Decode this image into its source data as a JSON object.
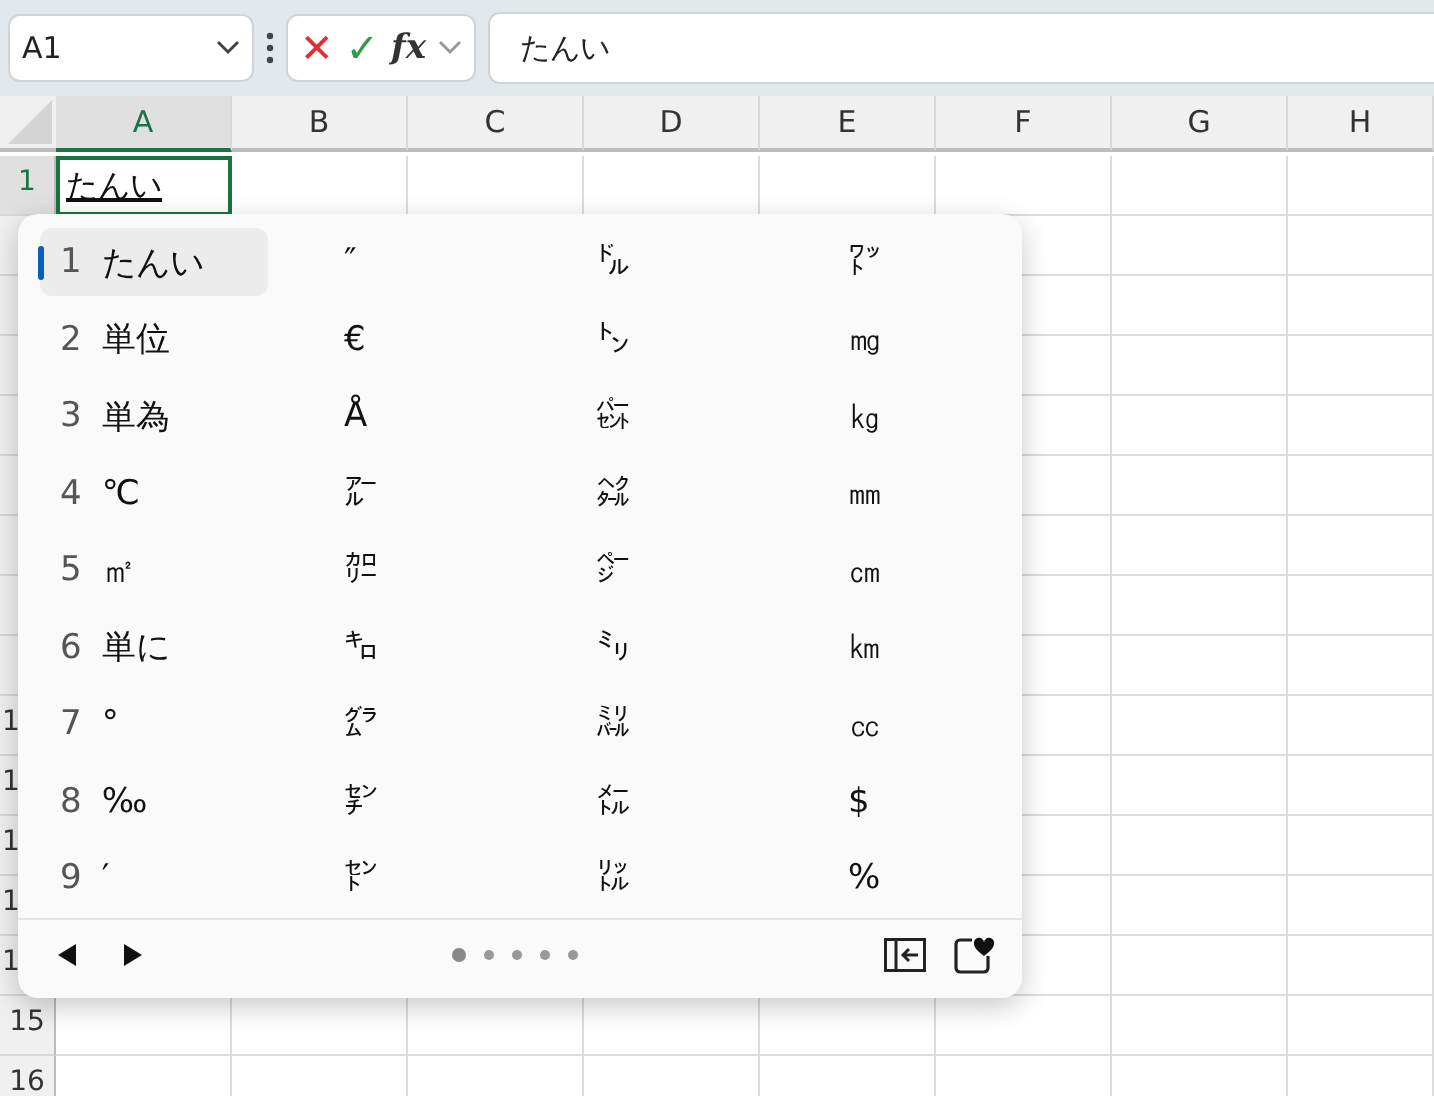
{
  "formula_bar": {
    "name_box": "A1",
    "cancel": "✕",
    "enter": "✓",
    "fx": "fx",
    "formula": "たんい"
  },
  "columns": [
    {
      "label": "A",
      "selected": true
    },
    {
      "label": "B",
      "selected": false
    },
    {
      "label": "C",
      "selected": false
    },
    {
      "label": "D",
      "selected": false
    },
    {
      "label": "E",
      "selected": false
    },
    {
      "label": "F",
      "selected": false
    },
    {
      "label": "G",
      "selected": false
    },
    {
      "label": "H",
      "selected": false
    }
  ],
  "top_rows": [
    {
      "label": "1",
      "selected": true
    }
  ],
  "lower_rows": [
    {
      "label": "1",
      "selected": false
    },
    {
      "label": "1",
      "selected": false
    },
    {
      "label": "1",
      "selected": false
    },
    {
      "label": "1",
      "selected": false
    },
    {
      "label": "1",
      "selected": false
    },
    {
      "label": "15",
      "selected": false
    },
    {
      "label": "16",
      "selected": false
    }
  ],
  "active_cell": {
    "value": "たんい",
    "composing": true
  },
  "candidates": {
    "rows": [
      {
        "number": "1",
        "text": "たんい",
        "selected": true,
        "others": [
          "″",
          "㌦",
          "㍗"
        ]
      },
      {
        "number": "2",
        "text": "単位",
        "selected": false,
        "others": [
          "€",
          "㌧",
          "㎎"
        ]
      },
      {
        "number": "3",
        "text": "単為",
        "selected": false,
        "others": [
          "Å",
          "㌫",
          "㎏"
        ]
      },
      {
        "number": "4",
        "text": "℃",
        "selected": false,
        "others": [
          "㌃",
          "㌶",
          "㎜"
        ]
      },
      {
        "number": "5",
        "text": "㎡",
        "selected": false,
        "others": [
          "㌍",
          "㌻",
          "㎝"
        ]
      },
      {
        "number": "6",
        "text": "単に",
        "selected": false,
        "others": [
          "㌔",
          "㍉",
          "㎞"
        ]
      },
      {
        "number": "7",
        "text": "°",
        "selected": false,
        "others": [
          "㌘",
          "㍊",
          "㏄"
        ]
      },
      {
        "number": "8",
        "text": "‰",
        "selected": false,
        "others": [
          "㌢",
          "㍍",
          "$"
        ]
      },
      {
        "number": "9",
        "text": "′",
        "selected": false,
        "others": [
          "㌣",
          "㍑",
          "%"
        ]
      }
    ],
    "pages": [
      {
        "selected": true
      },
      {
        "selected": false
      },
      {
        "selected": false
      },
      {
        "selected": false
      },
      {
        "selected": false
      }
    ]
  }
}
